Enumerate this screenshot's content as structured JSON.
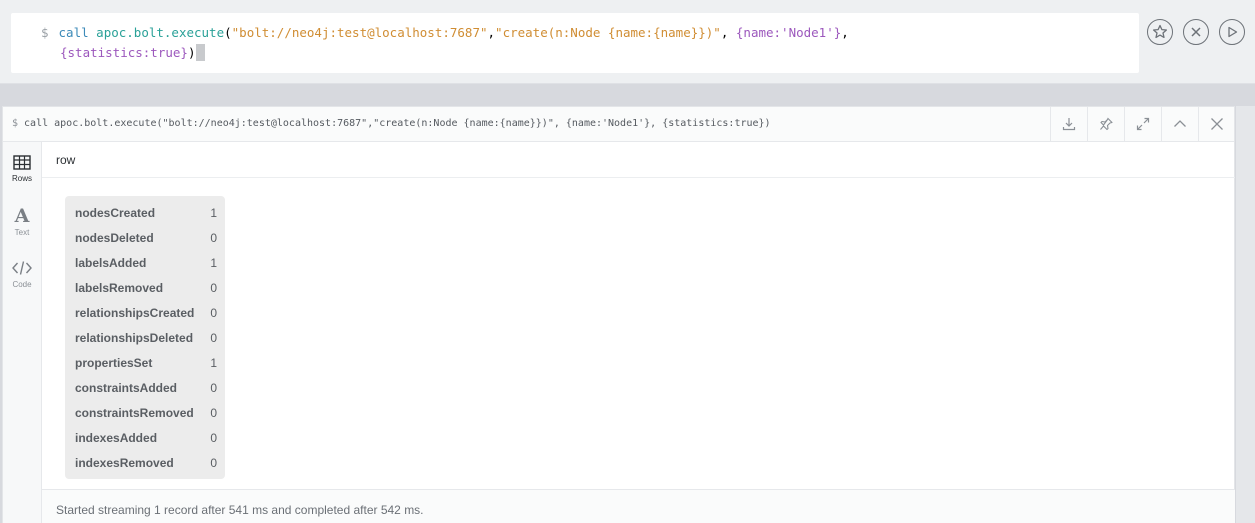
{
  "editor": {
    "prompt": "$",
    "line1": {
      "kw": "call",
      "fn": "apoc.bolt.execute",
      "paren_open": "(",
      "arg1": "\"bolt://neo4j:test@localhost:7687\"",
      "comma1": ",",
      "arg2": "\"create(n:Node {name:{name}})\"",
      "comma2": ", ",
      "arg3": "{name:'Node1'}",
      "comma3": ","
    },
    "line2": {
      "arg4": "{statistics:true}",
      "paren_close": ")"
    },
    "buttons": [
      "favorite",
      "clear",
      "run"
    ]
  },
  "frame": {
    "command": "call apoc.bolt.execute(\"bolt://neo4j:test@localhost:7687\",\"create(n:Node {name:{name}})\", {name:'Node1'}, {statistics:true})",
    "prompt": "$",
    "sidebar": [
      {
        "label": "Rows",
        "icon": "table-icon",
        "active": true
      },
      {
        "label": "Text",
        "icon": "text-icon",
        "active": false
      },
      {
        "label": "Code",
        "icon": "code-icon",
        "active": false
      }
    ],
    "column_header": "row",
    "stats": [
      {
        "key": "nodesCreated",
        "value": "1"
      },
      {
        "key": "nodesDeleted",
        "value": "0"
      },
      {
        "key": "labelsAdded",
        "value": "1"
      },
      {
        "key": "labelsRemoved",
        "value": "0"
      },
      {
        "key": "relationshipsCreated",
        "value": "0"
      },
      {
        "key": "relationshipsDeleted",
        "value": "0"
      },
      {
        "key": "propertiesSet",
        "value": "1"
      },
      {
        "key": "constraintsAdded",
        "value": "0"
      },
      {
        "key": "constraintsRemoved",
        "value": "0"
      },
      {
        "key": "indexesAdded",
        "value": "0"
      },
      {
        "key": "indexesRemoved",
        "value": "0"
      }
    ],
    "status": "Started streaming 1 record after 541 ms and completed after 542 ms."
  }
}
